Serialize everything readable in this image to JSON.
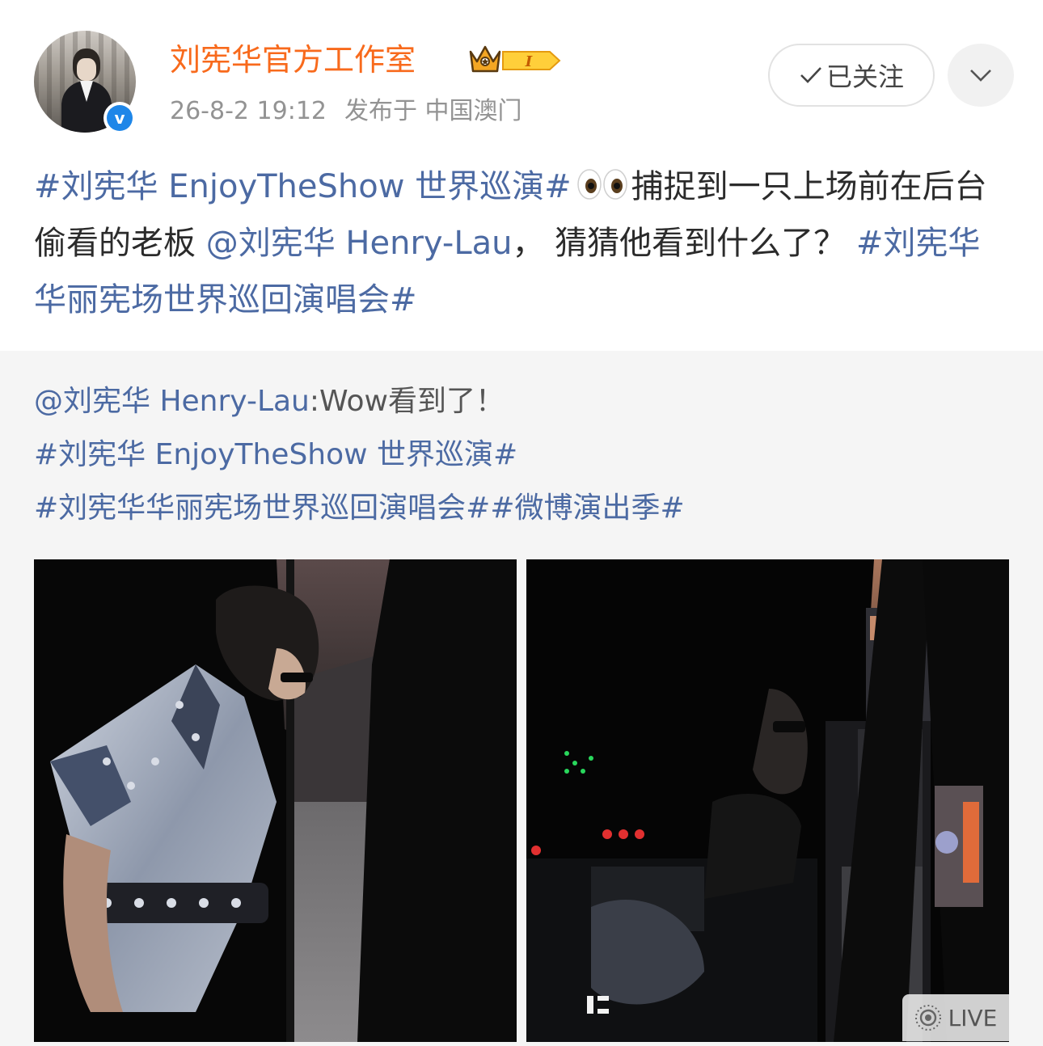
{
  "author": {
    "name": "刘宪华官方工作室",
    "verified_icon": "verified-icon",
    "crown_icon": "crown-icon",
    "level_badge": "I",
    "timestamp": "26-8-2 19:12",
    "location": "发布于 中国澳门"
  },
  "actions": {
    "follow_label": "已关注",
    "more_icon": "chevron-down-icon"
  },
  "post": {
    "hashtag1": "#刘宪华 EnjoyTheShow 世界巡演#",
    "text1": "捕捉到一只上场前在后台偷看的老板",
    "mention": "@刘宪华 Henry-Lau",
    "text2": "， 猜猜他看到什么了？",
    "hashtag2": "#刘宪华华丽宪场世界巡回演唱会#"
  },
  "repost": {
    "mention": "@刘宪华 Henry-Lau",
    "text": ":Wow看到了！",
    "hashtag1": "#刘宪华 EnjoyTheShow 世界巡演#",
    "hashtag2": "#刘宪华华丽宪场世界巡回演唱会#",
    "hashtag3": "#微博演出季#"
  },
  "media": {
    "photos": [
      "backstage-photo-1",
      "backstage-photo-2"
    ],
    "live_label": "LIVE"
  },
  "colors": {
    "author_name": "#f86a1c",
    "link": "#4c6aa3",
    "verified": "#1e86e8"
  }
}
